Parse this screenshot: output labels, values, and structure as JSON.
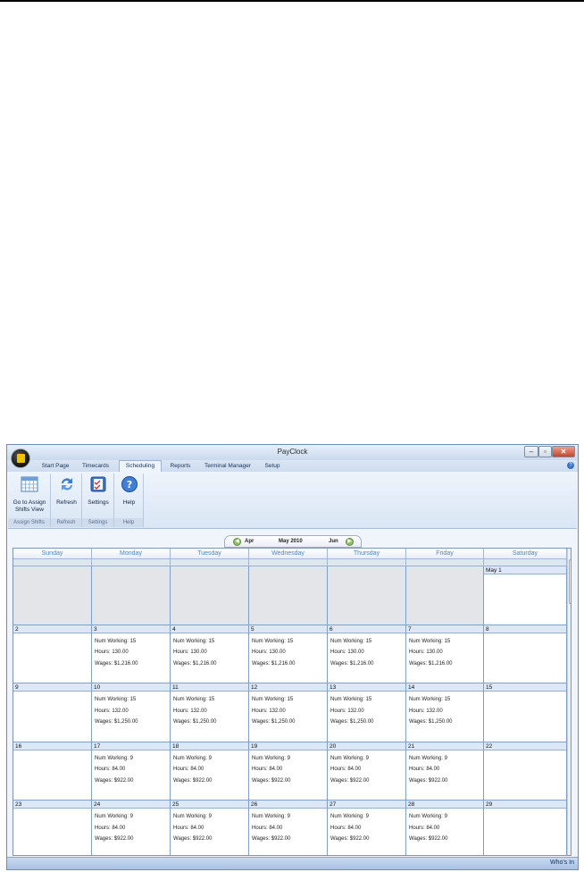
{
  "window": {
    "title": "PayClock"
  },
  "tabs": [
    {
      "label": "Start Page"
    },
    {
      "label": "Timecards"
    },
    {
      "label": "Scheduling"
    },
    {
      "label": "Reports"
    },
    {
      "label": "Terminal Manager"
    },
    {
      "label": "Setup"
    }
  ],
  "ribbon": {
    "groups": [
      {
        "label": "Assign Shifts",
        "buttons": [
          {
            "label_line1": "Go to Assign",
            "label_line2": "Shifts View",
            "icon": "calendar-grid-icon"
          }
        ]
      },
      {
        "label": "Refresh",
        "buttons": [
          {
            "label": "Refresh",
            "icon": "refresh-icon"
          }
        ]
      },
      {
        "label": "Settings",
        "buttons": [
          {
            "label": "Settings",
            "icon": "checklist-icon"
          }
        ]
      },
      {
        "label": "Help",
        "buttons": [
          {
            "label": "Help",
            "icon": "help-icon"
          }
        ]
      }
    ]
  },
  "calendar": {
    "prev": "Apr",
    "current": "May 2010",
    "next": "Jun",
    "days": [
      "Sunday",
      "Monday",
      "Tuesday",
      "Wednesday",
      "Thursday",
      "Friday",
      "Saturday"
    ],
    "labels": {
      "working": "Num Working: ",
      "hours": "Hours: ",
      "wages": "Wages: "
    },
    "weeks": [
      [
        {
          "d": ""
        },
        {
          "d": ""
        },
        {
          "d": ""
        },
        {
          "d": ""
        },
        {
          "d": ""
        },
        {
          "d": ""
        },
        {
          "d": "May 1"
        }
      ],
      [
        {
          "d": "2"
        },
        {
          "d": "3",
          "w": "15",
          "h": "130.00",
          "g": "$1,216.00"
        },
        {
          "d": "4",
          "w": "15",
          "h": "130.00",
          "g": "$1,216.00"
        },
        {
          "d": "5",
          "w": "15",
          "h": "130.00",
          "g": "$1,216.00"
        },
        {
          "d": "6",
          "w": "15",
          "h": "130.00",
          "g": "$1,216.00"
        },
        {
          "d": "7",
          "w": "15",
          "h": "130.00",
          "g": "$1,216.00"
        },
        {
          "d": "8"
        }
      ],
      [
        {
          "d": "9"
        },
        {
          "d": "10",
          "w": "15",
          "h": "132.00",
          "g": "$1,250.00"
        },
        {
          "d": "11",
          "w": "15",
          "h": "132.00",
          "g": "$1,250.00"
        },
        {
          "d": "12",
          "w": "15",
          "h": "132.00",
          "g": "$1,250.00"
        },
        {
          "d": "13",
          "w": "15",
          "h": "132.00",
          "g": "$1,250.00"
        },
        {
          "d": "14",
          "w": "15",
          "h": "132.00",
          "g": "$1,250.00"
        },
        {
          "d": "15"
        }
      ],
      [
        {
          "d": "16"
        },
        {
          "d": "17",
          "w": "9",
          "h": "84.00",
          "g": "$922.00"
        },
        {
          "d": "18",
          "w": "9",
          "h": "84.00",
          "g": "$922.00"
        },
        {
          "d": "19",
          "w": "9",
          "h": "84.00",
          "g": "$922.00"
        },
        {
          "d": "20",
          "w": "9",
          "h": "84.00",
          "g": "$922.00"
        },
        {
          "d": "21",
          "w": "9",
          "h": "84.00",
          "g": "$922.00"
        },
        {
          "d": "22"
        }
      ],
      [
        {
          "d": "23"
        },
        {
          "d": "24",
          "w": "9",
          "h": "84.00",
          "g": "$922.00"
        },
        {
          "d": "25",
          "w": "9",
          "h": "84.00",
          "g": "$922.00"
        },
        {
          "d": "26",
          "w": "9",
          "h": "84.00",
          "g": "$922.00"
        },
        {
          "d": "27",
          "w": "9",
          "h": "84.00",
          "g": "$922.00"
        },
        {
          "d": "28",
          "w": "9",
          "h": "84.00",
          "g": "$922.00"
        },
        {
          "d": "29"
        }
      ]
    ]
  },
  "status": {
    "whos_in": "Who's In"
  },
  "colors": {
    "accent": "#4f86c6",
    "grid_line": "#7f9fcf",
    "inactive": "#e4e5e8"
  }
}
